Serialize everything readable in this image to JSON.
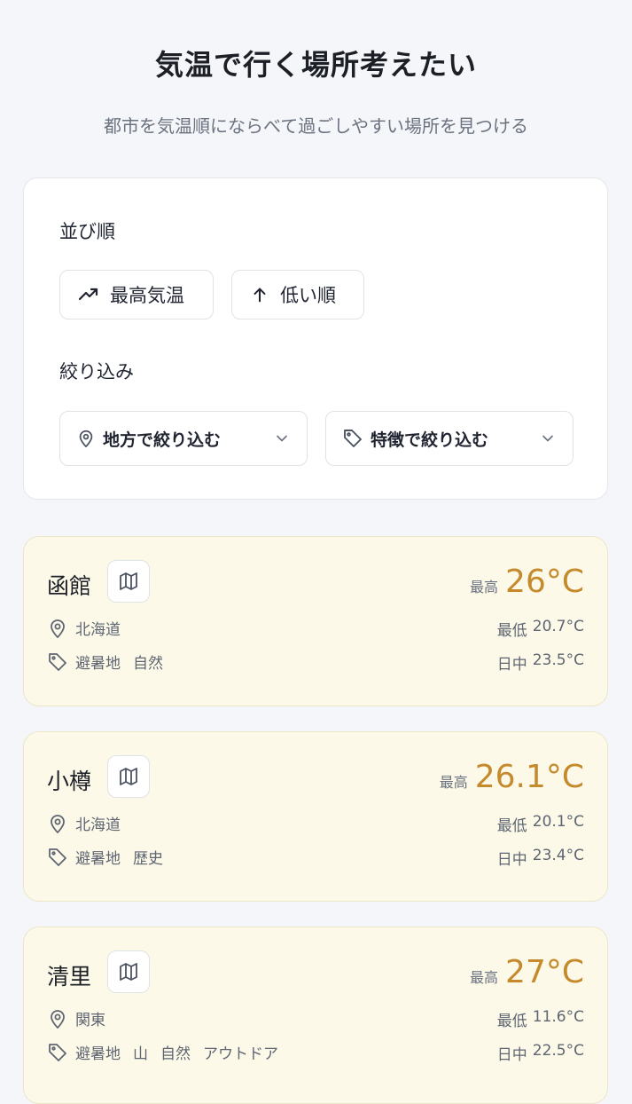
{
  "header": {
    "title": "気温で行く場所考えたい",
    "subtitle": "都市を気温順にならべて過ごしやすい場所を見つける"
  },
  "sort": {
    "label": "並び順",
    "metric_button": "最高気温",
    "order_button": "低い順"
  },
  "filter": {
    "label": "絞り込み",
    "region_select": "地方で絞り込む",
    "feature_select": "特徴で絞り込む"
  },
  "high_label": "最高",
  "low_label": "最低",
  "day_label": "日中",
  "cities": [
    {
      "name": "函館",
      "region": "北海道",
      "tags": [
        "避暑地",
        "自然"
      ],
      "high": "26°C",
      "low": "20.7°C",
      "day": "23.5°C"
    },
    {
      "name": "小樽",
      "region": "北海道",
      "tags": [
        "避暑地",
        "歴史"
      ],
      "high": "26.1°C",
      "low": "20.1°C",
      "day": "23.4°C"
    },
    {
      "name": "清里",
      "region": "関東",
      "tags": [
        "避暑地",
        "山",
        "自然",
        "アウトドア"
      ],
      "high": "27°C",
      "low": "11.6°C",
      "day": "22.5°C"
    }
  ],
  "icons": {
    "trend": "trending-up-icon",
    "arrow": "arrow-up-icon",
    "pin": "map-pin-icon",
    "tag": "tag-icon",
    "map": "map-icon",
    "chevron": "chevron-down-icon"
  },
  "colors": {
    "accent_temp": "#c58a2c",
    "card_bg": "#fcf9e9",
    "page_bg": "#f4f6f9"
  }
}
